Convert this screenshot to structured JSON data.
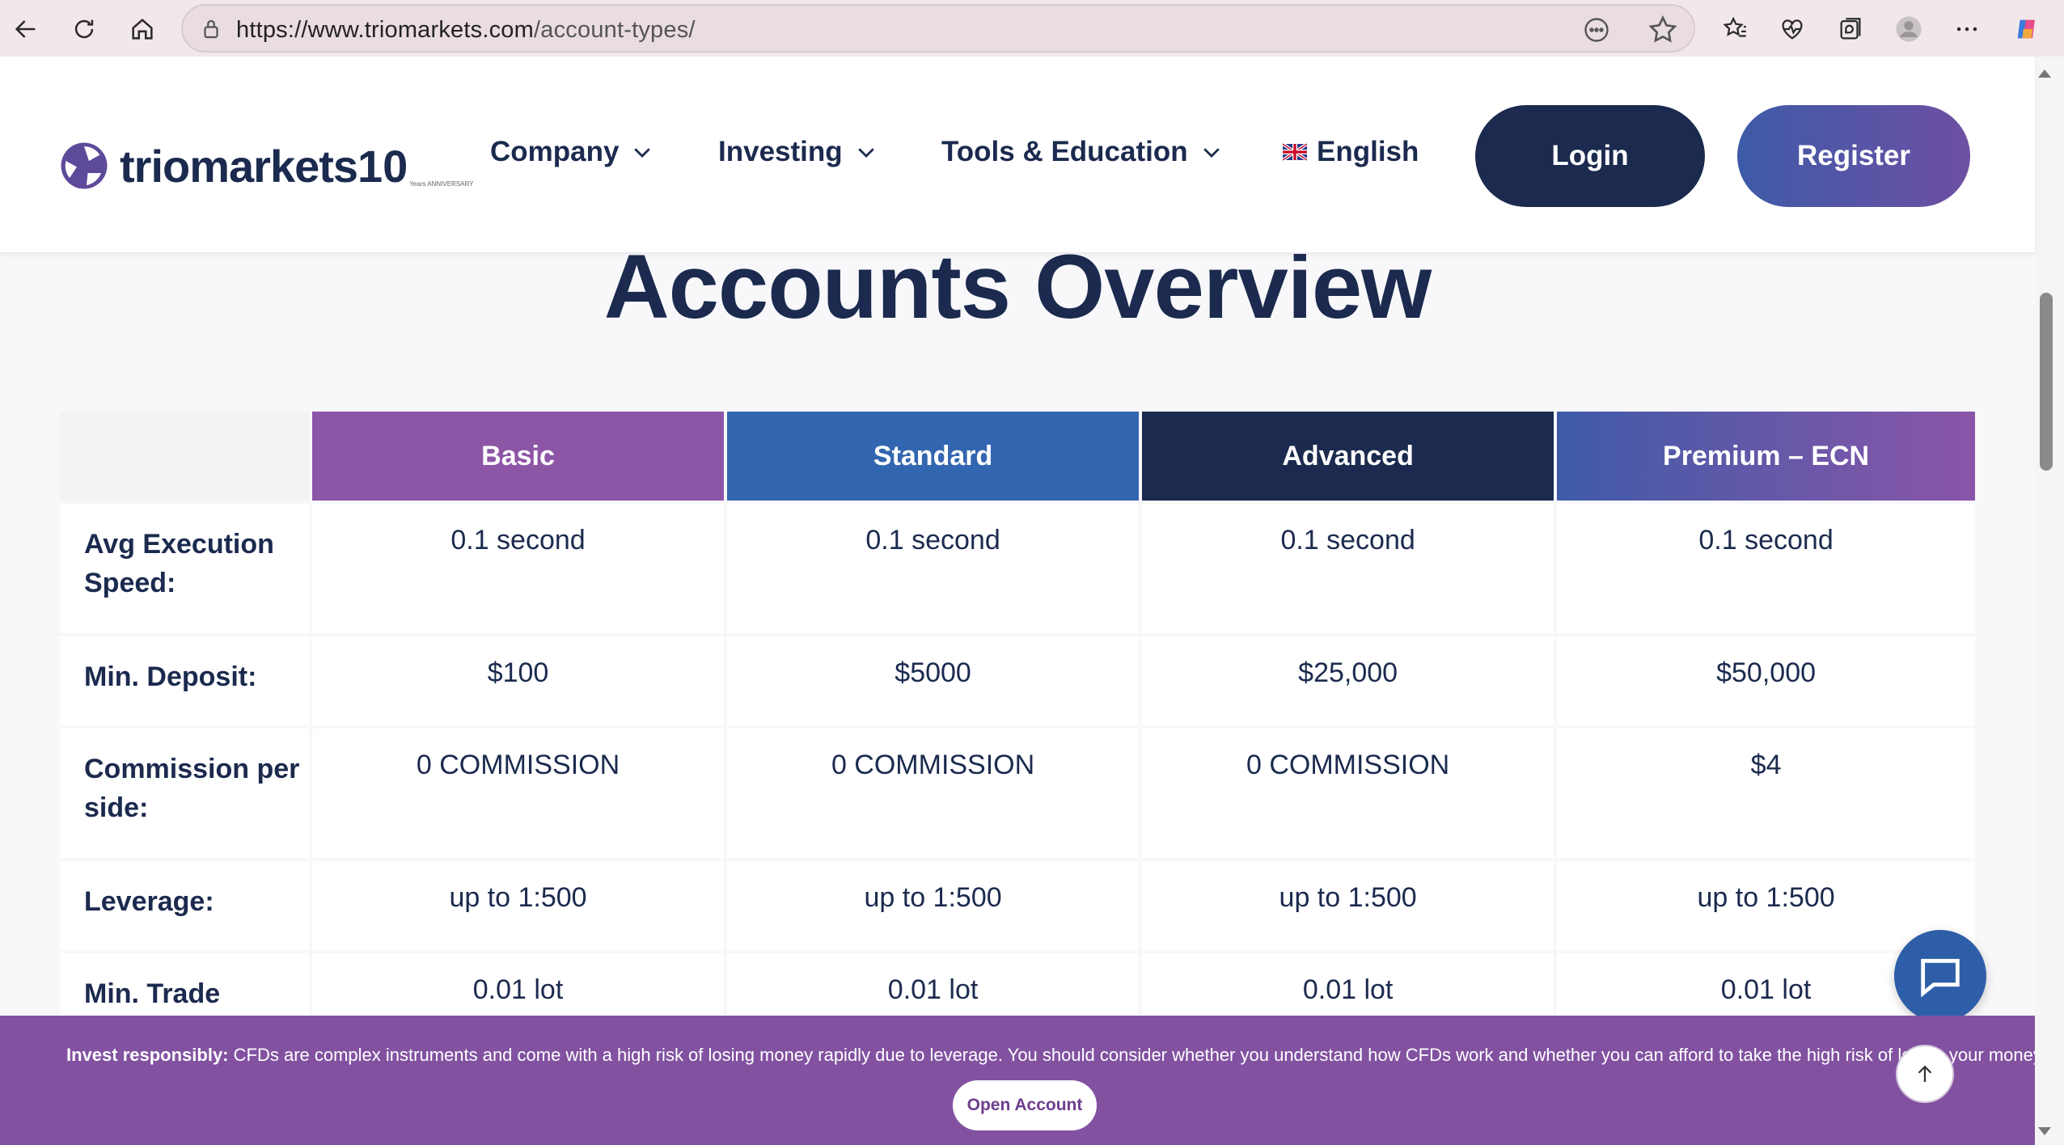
{
  "browser": {
    "url_host": "https://www.triomarkets.com",
    "url_path": "/account-types/"
  },
  "header": {
    "logo_text": "triomarkets",
    "logo_ten": "10",
    "logo_anniversary": "Years ANNIVERSARY",
    "nav": [
      {
        "label": "Company"
      },
      {
        "label": "Investing"
      },
      {
        "label": "Tools & Education"
      }
    ],
    "language": "English",
    "login_label": "Login",
    "register_label": "Register"
  },
  "main": {
    "title": "Accounts Overview",
    "columns": [
      "Basic",
      "Standard",
      "Advanced",
      "Premium – ECN"
    ],
    "rows": [
      {
        "label": "Avg Execution Speed:",
        "values": [
          "0.1 second",
          "0.1 second",
          "0.1 second",
          "0.1 second"
        ]
      },
      {
        "label": "Min. Deposit:",
        "values": [
          "$100",
          "$5000",
          "$25,000",
          "$50,000"
        ]
      },
      {
        "label": "Commission per side:",
        "values": [
          "0 COMMISSION",
          "0 COMMISSION",
          "0 COMMISSION",
          "$4"
        ]
      },
      {
        "label": "Leverage:",
        "values": [
          "up to 1:500",
          "up to 1:500",
          "up to 1:500",
          "up to 1:500"
        ]
      },
      {
        "label": "Min. Trade",
        "values": [
          "0.01 lot",
          "0.01 lot",
          "0.01 lot",
          "0.01 lot"
        ]
      }
    ]
  },
  "risk": {
    "bold": "Invest responsibly:",
    "text": " CFDs are complex instruments and come with a high risk of losing money rapidly due to leverage. You should consider whether you understand how CFDs work and whether you can afford to take the high risk of losing your money.",
    "button_label": "Open Account"
  },
  "colors": {
    "navy": "#1b2a4e",
    "purple": "#8d55a6",
    "blue": "#3366b0",
    "banner": "#8252a1"
  }
}
